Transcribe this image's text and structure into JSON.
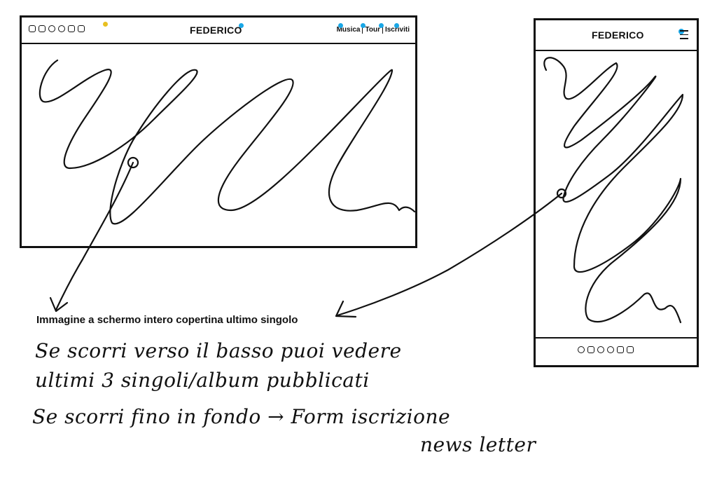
{
  "brand": "FEDERICO",
  "nav": [
    "Musica",
    "Tour",
    "Iscriviti"
  ],
  "social_icons": [
    "instagram-icon",
    "facebook-icon",
    "twitter-icon",
    "reddit-icon",
    "itunes-icon",
    "youtube-icon"
  ],
  "caption": "Immagine a schermo intero copertina ultimo singolo",
  "notes": {
    "line1": "Se scorri verso il basso puoi vedere",
    "line2": "ultimi 3 singoli/album pubblicati",
    "line3": "Se scorri fino in fondo → Form iscrizione",
    "line4": "news letter"
  },
  "colors": {
    "accent_blue": "#1aa7e6",
    "accent_yellow": "#e8c020",
    "ink": "#111111"
  }
}
